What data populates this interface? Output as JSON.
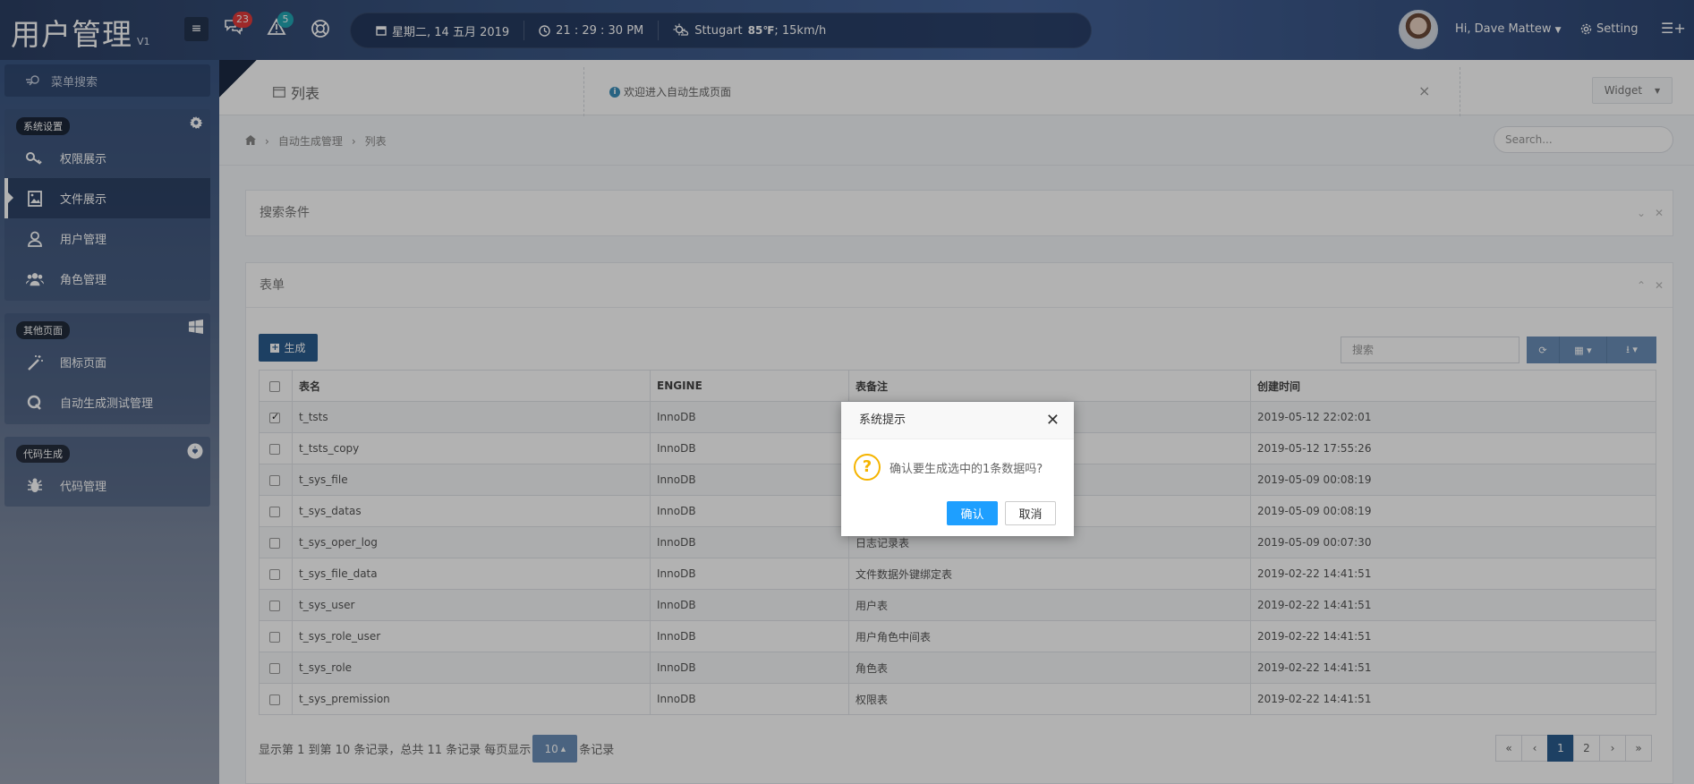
{
  "header": {
    "brand": "用户管理",
    "version": "V1",
    "messages_badge": "23",
    "alerts_badge": "5",
    "date": "星期二, 14 五月 2019",
    "time": "21 : 29 : 30 PM",
    "weather_city": "Sttugart",
    "weather_temp": "85℉",
    "weather_wind": "; 15km/h",
    "user_greeting": "Hi, Dave Mattew",
    "setting_label": "Setting"
  },
  "sidebar": {
    "search_placeholder": "菜单搜索",
    "groups": [
      {
        "tag": "系统设置",
        "items": [
          "权限展示",
          "文件展示",
          "用户管理",
          "角色管理"
        ]
      },
      {
        "tag": "其他页面",
        "items": [
          "图标页面",
          "自动生成测试管理"
        ]
      },
      {
        "tag": "代码生成",
        "items": [
          "代码管理"
        ]
      }
    ]
  },
  "main": {
    "page_title": "列表",
    "welcome": "欢迎进入自动生成页面",
    "widget_label": "Widget",
    "breadcrumb": [
      "自动生成管理",
      "列表"
    ],
    "search_placeholder": "Search...",
    "search_box_title": "搜索条件",
    "form_box_title": "表单",
    "generate_button": "生成",
    "table_search_placeholder": "搜索",
    "columns": [
      "表名",
      "ENGINE",
      "表备注",
      "创建时间"
    ],
    "rows": [
      {
        "name": "t_tsts",
        "engine": "InnoDB",
        "comment": "",
        "created": "2019-05-12 22:02:01",
        "checked": true
      },
      {
        "name": "t_tsts_copy",
        "engine": "InnoDB",
        "comment": "",
        "created": "2019-05-12 17:55:26",
        "checked": false
      },
      {
        "name": "t_sys_file",
        "engine": "InnoDB",
        "comment": "",
        "created": "2019-05-09 00:08:19",
        "checked": false
      },
      {
        "name": "t_sys_datas",
        "engine": "InnoDB",
        "comment": "",
        "created": "2019-05-09 00:08:19",
        "checked": false
      },
      {
        "name": "t_sys_oper_log",
        "engine": "InnoDB",
        "comment": "日志记录表",
        "created": "2019-05-09 00:07:30",
        "checked": false
      },
      {
        "name": "t_sys_file_data",
        "engine": "InnoDB",
        "comment": "文件数据外键绑定表",
        "created": "2019-02-22 14:41:51",
        "checked": false
      },
      {
        "name": "t_sys_user",
        "engine": "InnoDB",
        "comment": "用户表",
        "created": "2019-02-22 14:41:51",
        "checked": false
      },
      {
        "name": "t_sys_role_user",
        "engine": "InnoDB",
        "comment": "用户角色中间表",
        "created": "2019-02-22 14:41:51",
        "checked": false
      },
      {
        "name": "t_sys_role",
        "engine": "InnoDB",
        "comment": "角色表",
        "created": "2019-02-22 14:41:51",
        "checked": false
      },
      {
        "name": "t_sys_premission",
        "engine": "InnoDB",
        "comment": "权限表",
        "created": "2019-02-22 14:41:51",
        "checked": false
      }
    ],
    "footer_prefix": "显示第 1 到第 10 条记录，总共 11 条记录 每页显示",
    "page_size": "10",
    "footer_suffix": "条记录",
    "pager": [
      "«",
      "‹",
      "1",
      "2",
      "›",
      "»"
    ],
    "current_page": "1"
  },
  "dialog": {
    "title": "系统提示",
    "message": "确认要生成选中的1条数据吗?",
    "ok": "确认",
    "cancel": "取消"
  },
  "colors": {
    "accent": "#2a5c8f",
    "dialog_ok": "#1e9fff",
    "badge_red": "#e23b3b",
    "badge_teal": "#22a6b3"
  }
}
